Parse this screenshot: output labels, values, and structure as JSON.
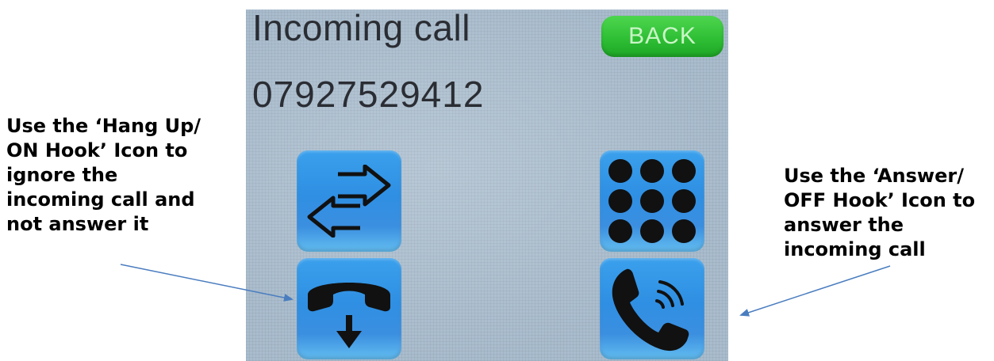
{
  "annotations": {
    "left": {
      "lines": [
        "Use the ‘Hang Up/",
        "ON Hook’ Icon to",
        "ignore the",
        "incoming call and",
        "not answer it"
      ]
    },
    "right": {
      "lines": [
        "Use the ‘Answer/",
        "OFF Hook’ Icon to",
        "answer the",
        "incoming call"
      ]
    }
  },
  "screen": {
    "title": "Incoming call",
    "caller_number": "07927529412",
    "back_label": "BACK",
    "buttons": [
      {
        "id": "transfer",
        "icon": "transfer-arrows-icon"
      },
      {
        "id": "keypad",
        "icon": "keypad-dots-icon"
      },
      {
        "id": "hangup",
        "icon": "hang-up-handset-icon"
      },
      {
        "id": "answer",
        "icon": "answer-handset-icon"
      }
    ]
  },
  "colors": {
    "screen_background": "#a9bccd",
    "tile_blue": "#2f8fe3",
    "back_green": "#2fbf35",
    "arrow_blue": "#4a7dbf"
  }
}
